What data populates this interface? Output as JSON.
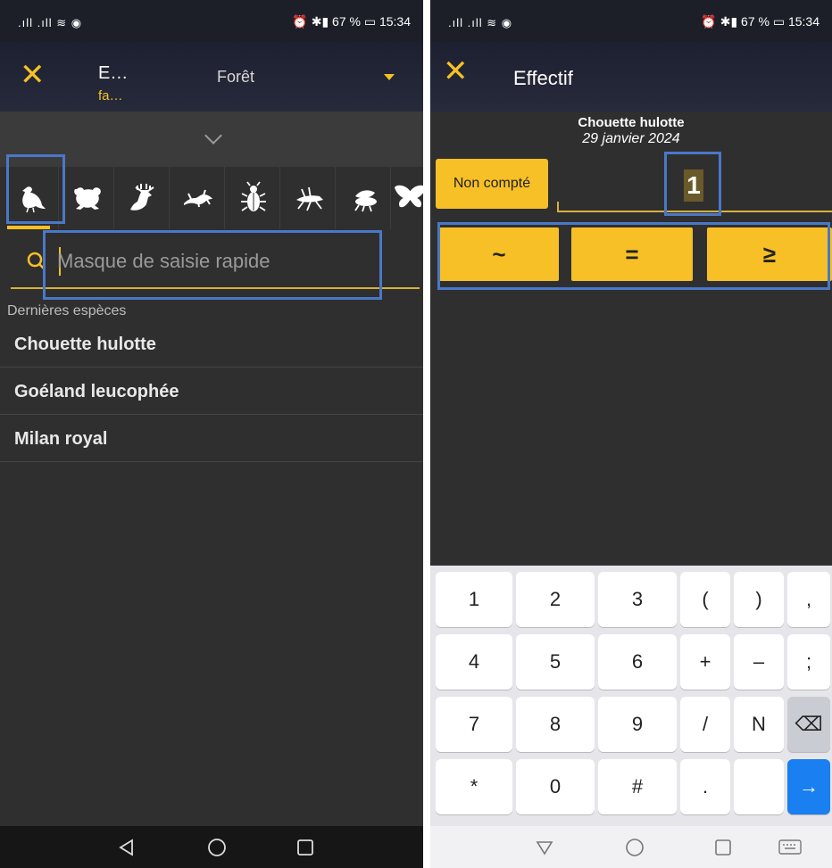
{
  "left": {
    "status": {
      "signal": "᯾ .ıll .ıll ≋ ◉",
      "right": "⏰ ✱▮ 67 % ▭ 15:34"
    },
    "appbar": {
      "title": "E…",
      "subtitle": "fa…",
      "location": "Forêt"
    },
    "tabs": [
      "bird-icon",
      "frog-icon",
      "deer-icon",
      "lizard-icon",
      "beetle-icon",
      "grasshopper-icon",
      "bee-icon",
      "butterfly-icon"
    ],
    "search": {
      "placeholder": "Masque de saisie rapide"
    },
    "recent_header": "Dernières espèces",
    "species": [
      "Chouette hulotte",
      "Goéland leucophée",
      "Milan royal"
    ]
  },
  "right": {
    "status": {
      "right": "⏰ ✱▮ 67 % ▭ 15:34"
    },
    "appbar": {
      "title": "Effectif"
    },
    "species_name": "Chouette hulotte",
    "date": "29 janvier 2024",
    "non_compte_label": "Non compté",
    "count_value": "1",
    "modifiers": [
      "~",
      "=",
      "≥"
    ],
    "keyboard": {
      "row1": [
        "1",
        "2",
        "3",
        "(",
        ")",
        ","
      ],
      "row2": [
        "4",
        "5",
        "6",
        "+",
        "–",
        ";"
      ],
      "row3": [
        "7",
        "8",
        "9",
        "/",
        "N",
        "⌫"
      ],
      "row4": [
        "*",
        "0",
        "#",
        ".",
        "",
        "→"
      ]
    }
  }
}
